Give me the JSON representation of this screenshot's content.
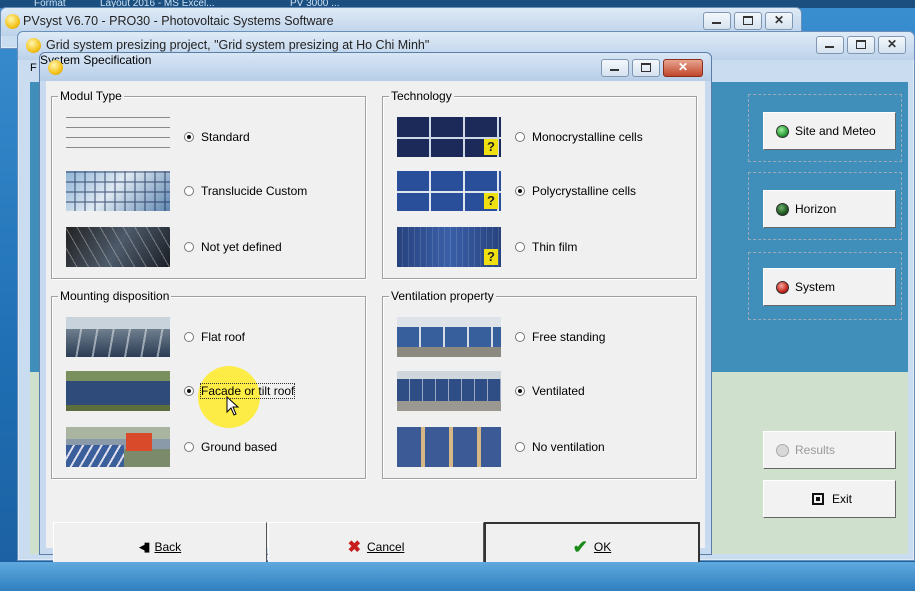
{
  "top_strip": {
    "left_text": "Format",
    "mid_text": "Layout 2016 - MS Excel...",
    "right_text": "PV 3000 ..."
  },
  "pvsyst_window": {
    "title": "PVsyst V6.70 - PRO30 - Photovoltaic Systems Software"
  },
  "project_window": {
    "title": "Grid system presizing project, \"Grid system presizing  at  Ho Chi Minh\"",
    "menu_letter": "F",
    "buttons": [
      {
        "label": "Site and Meteo",
        "led_color": "#2e9e3a"
      },
      {
        "label": "Horizon",
        "led_color": "#1e5a1e"
      },
      {
        "label": "System",
        "led_color": "#c8281e"
      },
      {
        "label": "Results",
        "led_color": "#b0b0b0",
        "disabled": true
      },
      {
        "label": "Exit",
        "icon": "exit-box-icon"
      }
    ]
  },
  "dialog": {
    "title": "System Specification",
    "groups": {
      "modul_type": {
        "label": "Modul Type",
        "options": [
          {
            "label": "Standard",
            "selected": true,
            "image": "standard-module-image"
          },
          {
            "label": "Translucide Custom",
            "selected": false,
            "image": "translucid-module-image"
          },
          {
            "label": "Not yet defined",
            "selected": false,
            "image": "undefined-module-image"
          }
        ]
      },
      "technology": {
        "label": "Technology",
        "options": [
          {
            "label": "Monocrystalline cells",
            "selected": false,
            "image": "mono-cells-image",
            "badge": "?"
          },
          {
            "label": "Polycrystalline cells",
            "selected": true,
            "image": "poly-cells-image",
            "badge": "?"
          },
          {
            "label": "Thin film",
            "selected": false,
            "image": "thin-film-image",
            "badge": "?"
          }
        ]
      },
      "mounting": {
        "label": "Mounting disposition",
        "options": [
          {
            "label": "Flat roof",
            "selected": false,
            "image": "flat-roof-image"
          },
          {
            "label": "Facade or tilt roof",
            "selected": true,
            "image": "tilt-roof-image"
          },
          {
            "label": "Ground based",
            "selected": false,
            "image": "ground-based-image"
          }
        ]
      },
      "ventilation": {
        "label": "Ventilation property",
        "options": [
          {
            "label": "Free standing",
            "selected": false,
            "image": "free-standing-image"
          },
          {
            "label": "Ventilated",
            "selected": true,
            "image": "ventilated-image"
          },
          {
            "label": "No ventilation",
            "selected": false,
            "image": "no-ventilation-image"
          }
        ]
      }
    },
    "footer": {
      "back": {
        "label": "Back",
        "icon": "back-arrow-icon"
      },
      "cancel": {
        "label": "Cancel",
        "icon": "red-x-icon",
        "color": "#c81e1e"
      },
      "ok": {
        "label": "OK",
        "icon": "green-check-icon",
        "color": "#1a8a1a"
      }
    }
  }
}
